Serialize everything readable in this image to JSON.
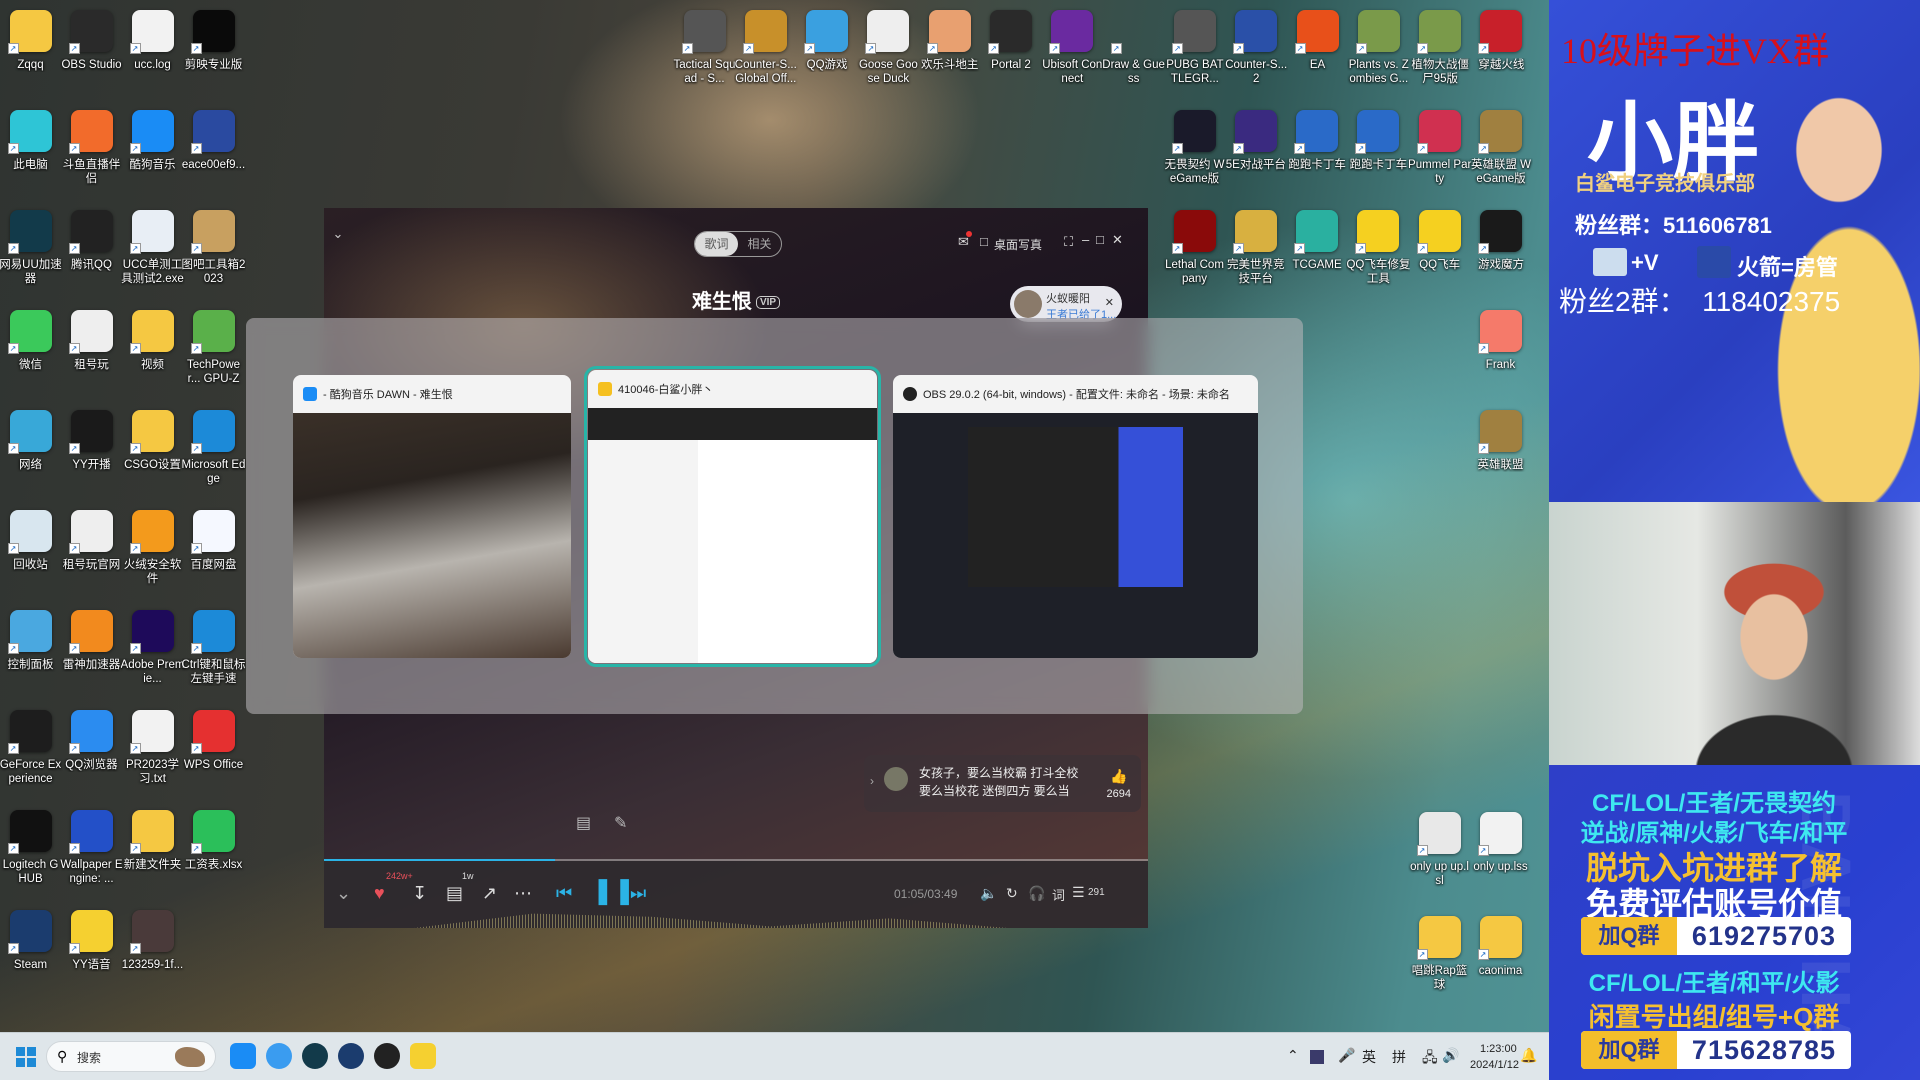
{
  "desktop": {
    "left_columns": [
      [
        {
          "label": "Zqqq",
          "icon": "folder-icon",
          "color": "#f5c842"
        },
        {
          "label": "此电脑",
          "icon": "computer-icon",
          "color": "#2ec5d6"
        },
        {
          "label": "网易UU加速器",
          "icon": "uu-accelerator-icon",
          "color": "#123a4a"
        },
        {
          "label": "微信",
          "icon": "wechat-icon",
          "color": "#3bc95b"
        },
        {
          "label": "网络",
          "icon": "network-icon",
          "color": "#38a8d8"
        },
        {
          "label": "回收站",
          "icon": "recycle-bin-icon",
          "color": "#d8e6ef"
        },
        {
          "label": "控制面板",
          "icon": "control-panel-icon",
          "color": "#4aa8e0"
        },
        {
          "label": "GeForce Experience",
          "icon": "geforce-icon",
          "color": "#1d1d1d"
        },
        {
          "label": "Logitech G HUB",
          "icon": "logitech-icon",
          "color": "#111111"
        },
        {
          "label": "Steam",
          "icon": "steam-icon",
          "color": "#1b3c6e"
        }
      ],
      [
        {
          "label": "OBS Studio",
          "icon": "obs-icon",
          "color": "#2a2a2a"
        },
        {
          "label": "斗鱼直播伴侣",
          "icon": "douyu-icon",
          "color": "#f26b2b"
        },
        {
          "label": "腾讯QQ",
          "icon": "qq-icon",
          "color": "#222222"
        },
        {
          "label": "租号玩",
          "icon": "zuhaowan-icon",
          "color": "#eeeeee"
        },
        {
          "label": "YY开播",
          "icon": "yy-live-icon",
          "color": "#1a1a1a"
        },
        {
          "label": "租号玩官网",
          "icon": "zuhaowan-icon",
          "color": "#eeeeee"
        },
        {
          "label": "雷神加速器",
          "icon": "leishen-icon",
          "color": "#f28a1e"
        },
        {
          "label": "QQ浏览器",
          "icon": "qq-browser-icon",
          "color": "#2b8cf0"
        },
        {
          "label": "Wallpaper Engine: ...",
          "icon": "wallpaper-engine-icon",
          "color": "#2350c8"
        },
        {
          "label": "YY语音",
          "icon": "yy-voice-icon",
          "color": "#f5d030"
        }
      ],
      [
        {
          "label": "ucc.log",
          "icon": "text-file-icon",
          "color": "#f2f2f2"
        },
        {
          "label": "酷狗音乐",
          "icon": "kugou-icon",
          "color": "#1a8cf5"
        },
        {
          "label": "UCC单测工具测试2.exe",
          "icon": "exe-icon",
          "color": "#e8eef5"
        },
        {
          "label": "视频",
          "icon": "folder-icon",
          "color": "#f5c842"
        },
        {
          "label": "CSGO设置",
          "icon": "folder-icon",
          "color": "#f5c842"
        },
        {
          "label": "火绒安全软件",
          "icon": "huorong-icon",
          "color": "#f39a1c"
        },
        {
          "label": "Adobe Premie...",
          "icon": "premiere-icon",
          "color": "#1e0a5a"
        },
        {
          "label": "PR2023学习.txt",
          "icon": "text-file-icon",
          "color": "#f2f2f2"
        },
        {
          "label": "新建文件夹",
          "icon": "folder-icon",
          "color": "#f5c842"
        },
        {
          "label": "123259-1f...",
          "icon": "image-file-icon",
          "color": "#4a3a3a"
        }
      ],
      [
        {
          "label": "剪映专业版",
          "icon": "capcut-icon",
          "color": "#0a0a0a"
        },
        {
          "label": "eace00ef9...",
          "icon": "file-icon",
          "color": "#2a4aa0"
        },
        {
          "label": "图吧工具箱2023",
          "icon": "toolbox-icon",
          "color": "#c8a060"
        },
        {
          "label": "TechPower... GPU-Z",
          "icon": "gpuz-icon",
          "color": "#5ab04a"
        },
        {
          "label": "Microsoft Edge",
          "icon": "edge-icon",
          "color": "#1c8ad8"
        },
        {
          "label": "百度网盘",
          "icon": "baidu-netdisk-icon",
          "color": "#f5f8ff"
        },
        {
          "label": "Ctrl键和鼠标左键手速测...",
          "icon": "edge-icon",
          "color": "#1c8ad8"
        },
        {
          "label": "WPS Office",
          "icon": "wps-icon",
          "color": "#e53030"
        },
        {
          "label": "工资表.xlsx",
          "icon": "spreadsheet-icon",
          "color": "#2bbf5a"
        }
      ]
    ],
    "top_row": [
      {
        "label": "Tactical Squad - S...",
        "icon": "tactical-squad-icon",
        "color": "#555555"
      },
      {
        "label": "Counter-S... Global Off...",
        "icon": "csgo-icon",
        "color": "#c8902a"
      },
      {
        "label": "QQ游戏",
        "icon": "qq-game-icon",
        "color": "#3aa0e0"
      },
      {
        "label": "Goose Goose Duck",
        "icon": "goose-icon",
        "color": "#eeeeee"
      },
      {
        "label": "欢乐斗地主",
        "icon": "doudizhu-icon",
        "color": "#e8a070"
      },
      {
        "label": "Portal 2",
        "icon": "portal-icon",
        "color": "#2a2a2a"
      },
      {
        "label": "Ubisoft Connect",
        "icon": "ubisoft-icon",
        "color": "#6a2aa0"
      },
      {
        "label": "Draw & Guess",
        "icon": "game-icon",
        "color": "transparent"
      },
      {
        "label": "PUBG BATTLEGR...",
        "icon": "pubg-icon",
        "color": "#555555"
      },
      {
        "label": "Counter-S... 2",
        "icon": "cs2-icon",
        "color": "#2a50a8"
      },
      {
        "label": "EA",
        "icon": "ea-icon",
        "color": "#e8501a"
      },
      {
        "label": "Plants vs. Zombies G...",
        "icon": "pvz-icon",
        "color": "#7a9a4a"
      },
      {
        "label": "植物大战僵尸95版",
        "icon": "pvz-icon",
        "color": "#7a9a4a"
      },
      {
        "label": "穿越火线",
        "icon": "crossfire-icon",
        "color": "#c8202a"
      }
    ],
    "right_rows": [
      [
        {
          "label": "无畏契约 WeGame版",
          "icon": "valorant-icon",
          "color": "#1a1a2a"
        },
        {
          "label": "5E对战平台",
          "icon": "5e-icon",
          "color": "#3a2a80"
        },
        {
          "label": "跑跑卡丁车",
          "icon": "kartrider-icon",
          "color": "#2a6ac8"
        },
        {
          "label": "跑跑卡丁车",
          "icon": "kartrider-icon",
          "color": "#2a6ac8"
        },
        {
          "label": "Pummel Party",
          "icon": "pummel-party-icon",
          "color": "#d03050"
        },
        {
          "label": "英雄联盟 WeGame版",
          "icon": "lol-icon",
          "color": "#a08040"
        }
      ],
      [
        {
          "label": "Lethal Company",
          "icon": "lethal-company-icon",
          "color": "#8a0a0a"
        },
        {
          "label": "完美世界竞技平台",
          "icon": "perfect-world-icon",
          "color": "#d8b040"
        },
        {
          "label": "TCGAME",
          "icon": "tcgame-icon",
          "color": "#2ab0a0"
        },
        {
          "label": "QQ飞车修复工具",
          "icon": "qq-speed-icon",
          "color": "#f5d020"
        },
        {
          "label": "QQ飞车",
          "icon": "qq-speed-icon",
          "color": "#f5d020"
        },
        {
          "label": "游戏魔方",
          "icon": "game-cube-icon",
          "color": "#1a1a1a"
        }
      ],
      [
        {
          "label": "Frank",
          "icon": "flame-icon",
          "color": "#f57a6a"
        }
      ],
      [
        {
          "label": "英雄联盟",
          "icon": "lol-icon",
          "color": "#a08040"
        }
      ]
    ],
    "bottom_right": [
      [
        {
          "label": "only up up.lsl",
          "icon": "lsl-file-icon",
          "color": "#e8e8e8"
        },
        {
          "label": "only up.lss",
          "icon": "lss-file-icon",
          "color": "#f2f2f2"
        }
      ],
      [
        {
          "label": "唱跳Rap篮球",
          "icon": "folder-icon",
          "color": "#f5c842"
        },
        {
          "label": "caonima",
          "icon": "folder-icon",
          "color": "#f5c842"
        }
      ]
    ]
  },
  "player": {
    "tabs": [
      {
        "label": "歌词",
        "active": true
      },
      {
        "label": "相关",
        "active": false
      }
    ],
    "desktop_photo": "桌面写真",
    "song_title": "难生恨",
    "vip_badge": "VIP",
    "notification": {
      "name": "火蚁暖阳",
      "message": "王者已给了1..."
    },
    "comment": {
      "text": "女孩子，要么当校霸 打斗全校 要么当校花 迷倒四方 要么当学霸 名声四散...",
      "likes": "2694"
    },
    "likes_badge": "242w+",
    "comments_badge": "1w",
    "time": "01:05/03:49",
    "progress": 0.28,
    "lyrics_label": "词",
    "playlist_count": "291",
    "accent": "#2bb3e6"
  },
  "alttab": {
    "windows": [
      {
        "title": "- 酷狗音乐 DAWN - 难生恨",
        "selected": false,
        "icon_color": "#1a8cf5"
      },
      {
        "title": "410046-白鲨小胖丶",
        "selected": true,
        "icon_color": "#f5c020"
      },
      {
        "title": "OBS 29.0.2 (64-bit, windows) - 配置文件: 未命名 - 场景: 未命名",
        "selected": false,
        "icon_color": "#222222"
      }
    ],
    "selection_color": "#28b5a8"
  },
  "stream": {
    "banner_red": "10级牌子进VX群",
    "name": "小胖",
    "club": "白鲨电子竞技俱乐部",
    "fan_group": "粉丝群：511606781",
    "plane_text": "+V",
    "rocket_text": "火箭=房管",
    "fan_group2": "粉丝2群：  118402375",
    "watermark": "BAISHA",
    "ad": {
      "line1": "CF/LOL/王者/无畏契约",
      "line2": "逆战/原神/火影/飞车/和平",
      "line3": "脱坑入坑进群了解",
      "line4": "免费评估账号价值",
      "q_label": "加Q群",
      "q1": "619275703",
      "line5": "CF/LOL/王者/和平/火影",
      "line6": "闲置号出组/组号+Q群",
      "q2": "715628785"
    }
  },
  "taskbar": {
    "search_placeholder": "搜索",
    "lang": "英",
    "ime": "拼",
    "time": "1:23:00",
    "date": "2024/1/12",
    "apps": [
      {
        "icon": "kugou-icon",
        "color": "#1a8cf5"
      },
      {
        "icon": "qq-browser-icon",
        "color": "#3a9cf0"
      },
      {
        "icon": "uu-accelerator-icon",
        "color": "#123a4a"
      },
      {
        "icon": "steam-icon",
        "color": "#1b3c6e"
      },
      {
        "icon": "obs-icon",
        "color": "#222222"
      },
      {
        "icon": "yy-voice-icon",
        "color": "#f5d030"
      }
    ]
  }
}
